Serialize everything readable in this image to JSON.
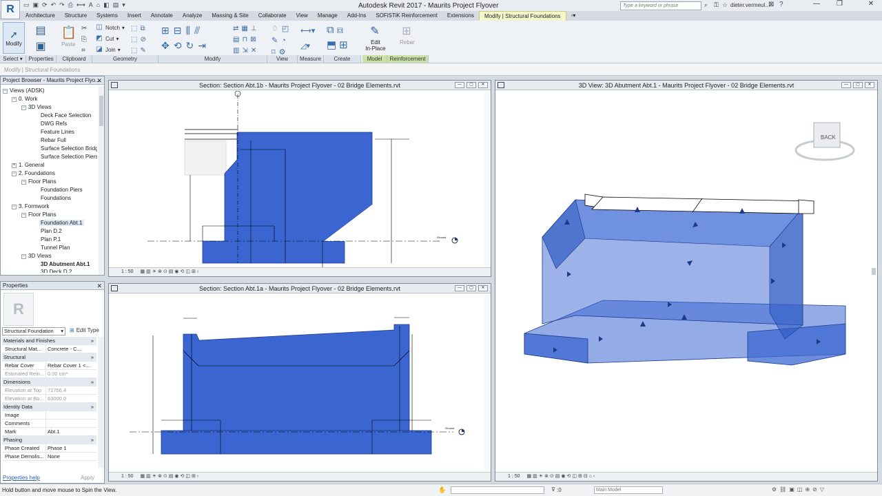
{
  "app": {
    "logo": "R",
    "title": "Autodesk Revit 2017  -   Maurits Project Flyover",
    "search_placeholder": "Type a keyword or phrase",
    "user": "dieter.vermeul..."
  },
  "tabs": [
    "Architecture",
    "Structure",
    "Systems",
    "Insert",
    "Annotate",
    "Analyze",
    "Massing & Site",
    "Collaborate",
    "View",
    "Manage",
    "Add-Ins",
    "SOFiSTiK Reinforcement",
    "Extensions",
    "Modify | Structural Foundations"
  ],
  "ribbon": {
    "modify_label": "Modify",
    "paste_label": "Paste",
    "notch": "Notch",
    "cut": "Cut",
    "join": "Join",
    "edit_in_place": [
      "Edit",
      "In-Place"
    ],
    "rebar": "Rebar",
    "panels": [
      "Select",
      "Properties",
      "Clipboard",
      "Geometry",
      "Modify",
      "View",
      "Measure",
      "Create",
      "Model",
      "Reinforcement"
    ]
  },
  "options_bar": "Modify | Structural Foundations",
  "project_browser": {
    "title": "Project Browser - Maurits Project Flyo...",
    "items": [
      {
        "label": "Views (ADSK)"
      },
      {
        "label": "0. Work"
      },
      {
        "label": "3D Views"
      },
      {
        "label": "Deck Face Selection"
      },
      {
        "label": "DWG Refs"
      },
      {
        "label": "Feature Lines"
      },
      {
        "label": "Rebar Full"
      },
      {
        "label": "Surface Selection Bridg"
      },
      {
        "label": "Surface Selection Piers"
      },
      {
        "label": "1. General"
      },
      {
        "label": "2. Foundations"
      },
      {
        "label": "Floor Plans"
      },
      {
        "label": "Foundation Piers"
      },
      {
        "label": "Foundations"
      },
      {
        "label": "3. Formwork"
      },
      {
        "label": "Floor Plans"
      },
      {
        "label": "Foundation Abt.1"
      },
      {
        "label": "Plan D.2"
      },
      {
        "label": "Plan P.1"
      },
      {
        "label": "Tunnel Plan"
      },
      {
        "label": "3D Views"
      },
      {
        "label": "3D Abutment Abt.1"
      },
      {
        "label": "3D Deck D.2"
      }
    ]
  },
  "properties": {
    "title": "Properties",
    "type_selector": "Structural Foundation",
    "edit_type": "Edit Type",
    "groups": {
      "materials": "Materials and Finishes",
      "structural": "Structural",
      "dimensions": "Dimensions",
      "identity": "Identity Data",
      "phasing": "Phasing"
    },
    "rows": {
      "material": {
        "k": "Structural Mat...",
        "v": "Concrete - C..."
      },
      "rebar_cover": {
        "k": "Rebar Cover",
        "v": "Rebar Cover 1 <..."
      },
      "est_reinf": {
        "k": "Estimated Rein...",
        "v": "0.00 cm³"
      },
      "elev_top": {
        "k": "Elevation at Top",
        "v": "71756.4"
      },
      "elev_bottom": {
        "k": "Elevation at Bo...",
        "v": "63000.0"
      },
      "image": {
        "k": "Image",
        "v": ""
      },
      "comments": {
        "k": "Comments",
        "v": ""
      },
      "mark": {
        "k": "Mark",
        "v": "Abt.1"
      },
      "phase_created": {
        "k": "Phase Created",
        "v": "Phase 1"
      },
      "phase_demol": {
        "k": "Phase Demolis...",
        "v": "None"
      }
    },
    "help": "Properties help",
    "apply": "Apply"
  },
  "views": {
    "section_b": {
      "title": "Section: Section Abt.1b - Maurits Project Flyover - 02 Bridge Elements.rvt",
      "scale": "1 : 50",
      "ground": "Ground"
    },
    "section_a": {
      "title": "Section: Section Abt.1a - Maurits Project Flyover - 02 Bridge Elements.rvt",
      "scale": "1 : 50",
      "ground": "Ground"
    },
    "view3d": {
      "title": "3D View: 3D Abutment Abt.1 - Maurits Project Flyover - 02 Bridge Elements.rvt",
      "scale": "1 : 50",
      "viewcube": "BACK"
    }
  },
  "status": {
    "text": "Hold button and move mouse to Spin the View.",
    "selection_count": ":0",
    "workset": "Main Model"
  },
  "colors": {
    "element_fill": "#3b66d1",
    "selection_blue": "#5a7fe0"
  }
}
